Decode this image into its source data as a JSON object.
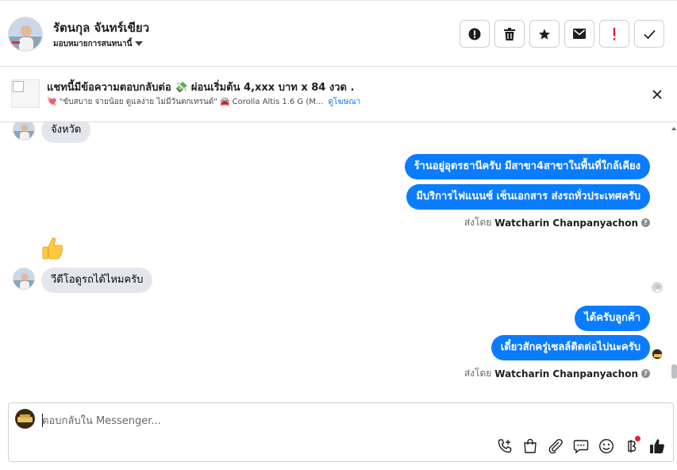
{
  "header": {
    "contact_name": "รัตนกุล จันทร์เขียว",
    "assign_label": "มอบหมายการสนทนานี้",
    "toolbar": [
      {
        "name": "alert-icon"
      },
      {
        "name": "trash-icon"
      },
      {
        "name": "star-icon"
      },
      {
        "name": "envelope-icon"
      },
      {
        "name": "exclamation-icon",
        "color": "#e41e3f"
      },
      {
        "name": "check-icon"
      }
    ]
  },
  "ad": {
    "title": "แชทนี้มีข้อความตอบกลับต่อ 💸 ผ่อนเริ่มต้น 4,xxx บาท x 84 งวด .",
    "subtitle": "💘 \"ขับสบาย จ่ายน้อย ดูแลง่าย ไม่มีวันตกเทรนด์\" 🚘 Corolla Altis 1.6 G (M...",
    "link_label": "ดูโฆษณา"
  },
  "messages": {
    "in_1": "จังหวัด",
    "out_1": "ร้านอยู่อุดรธานีครับ มีสาขา4สาขาในพื้นที่ใกล้เคียง",
    "out_2": "มีบริการไฟแนนซ์ เซ็นเอกสาร ส่งรถทั่วประเทศครับ",
    "sent_by_prefix_1": "ส่งโดย",
    "sent_by_name_1": "Watcharin Chanpanyachon",
    "thumbs_emoji": "👍",
    "in_2": "วีดีโอดูรถได้ไหมครับ",
    "out_3": "ได้ครับลูกค้า",
    "out_4": "เดี๋ยวสักครู่เซลล์ติดต่อไปนะครับ",
    "sent_by_prefix_2": "ส่งโดย",
    "sent_by_name_2": "Watcharin Chanpanyachon",
    "help_mark": "?"
  },
  "composer": {
    "placeholder": "ตอบกลับใน Messenger...",
    "tools": [
      "phone-plus-icon",
      "shopping-bag-icon",
      "paperclip-icon",
      "chat-bubble-icon",
      "smiley-icon",
      "baht-icon",
      "thumbs-up-icon"
    ],
    "accent_color": "#0a7cff",
    "notification_color": "#e41e3f"
  }
}
